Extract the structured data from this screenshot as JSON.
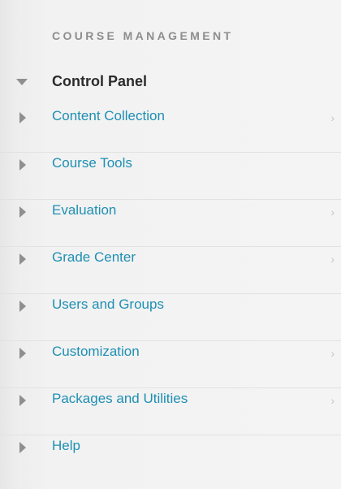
{
  "section": {
    "title": "COURSE MANAGEMENT"
  },
  "control_panel": {
    "label": "Control Panel",
    "expanded": true,
    "icon": "collapse-triangle-down-icon"
  },
  "menu": {
    "items": [
      {
        "label": "Content Collection",
        "has_submenu": true
      },
      {
        "label": "Course Tools",
        "has_submenu": false
      },
      {
        "label": "Evaluation",
        "has_submenu": true
      },
      {
        "label": "Grade Center",
        "has_submenu": true
      },
      {
        "label": "Users and Groups",
        "has_submenu": false
      },
      {
        "label": "Customization",
        "has_submenu": true
      },
      {
        "label": "Packages and Utilities",
        "has_submenu": true
      },
      {
        "label": "Help",
        "has_submenu": false
      }
    ],
    "chevron_glyph": "›"
  },
  "colors": {
    "link": "#1e8fb3",
    "section_title": "#8d8d8d",
    "heading": "#2b2b2b",
    "arrow": "#8f8f8f",
    "chevron": "#c6c6c6",
    "background": "#f2f2f2"
  }
}
